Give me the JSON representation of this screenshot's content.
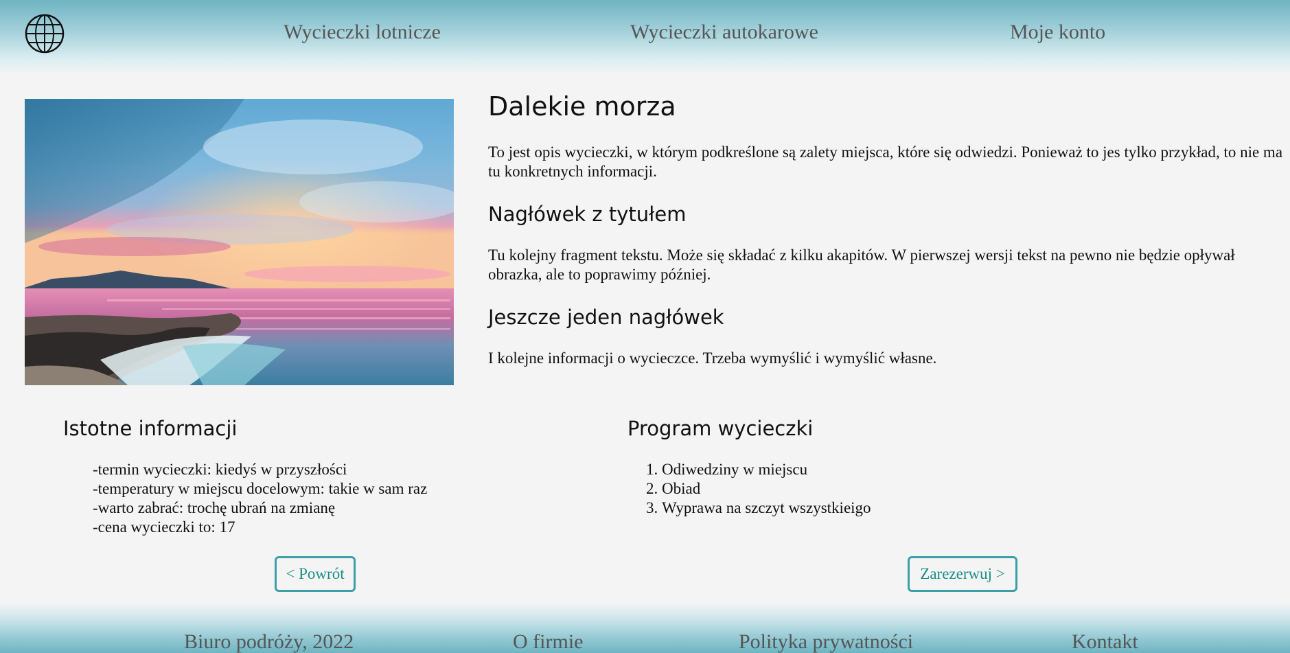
{
  "header": {
    "logo_icon": "globe-icon",
    "nav": [
      {
        "label": "Wycieczki lotnicze"
      },
      {
        "label": "Wycieczki autokarowe"
      },
      {
        "label": "Moje konto"
      }
    ]
  },
  "hero": {
    "icon": "sunset-sea-photo"
  },
  "article": {
    "title": "Dalekie morza",
    "intro": "To jest opis wycieczki, w którym podkreślone są zalety miejsca, które się odwiedzi. Ponieważ to jes tylko przykład, to nie ma tu konkretnych informacji.",
    "sections": [
      {
        "heading": "Nagłówek z tytułem",
        "text": "Tu kolejny fragment tekstu. Może się składać z kilku akapitów. W pierwszej wersji tekst na pewno nie będzie opływał obrazka, ale to poprawimy później."
      },
      {
        "heading": "Jeszcze jeden nagłówek",
        "text": "I kolejne informacji o wycieczce. Trzeba wymyślić i wymyślić własne."
      }
    ]
  },
  "info": {
    "heading": "Istotne informacji",
    "items": [
      "-termin wycieczki: kiedyś w przyszłości",
      "-temperatury w miejscu docelowym: takie w sam raz",
      "-warto zabrać: trochę ubrań na zmianę",
      "-cena wycieczki to: 17"
    ]
  },
  "program": {
    "heading": "Program wycieczki",
    "items": [
      "Odiwedziny w miejscu",
      "Obiad",
      "Wyprawa na szczyt wszystkieigo"
    ]
  },
  "buttons": {
    "back": "< Powrót",
    "reserve": "Zarezerwuj >"
  },
  "footer": {
    "links": [
      {
        "label": "Biuro podróży, 2022"
      },
      {
        "label": "O firmie"
      },
      {
        "label": "Polityka prywatności"
      },
      {
        "label": "Kontakt"
      }
    ]
  },
  "colors": {
    "accent": "#3d9ea8",
    "button_text": "#1c8f86",
    "header_top": "#6eb4c2",
    "nav_text": "#555555"
  }
}
